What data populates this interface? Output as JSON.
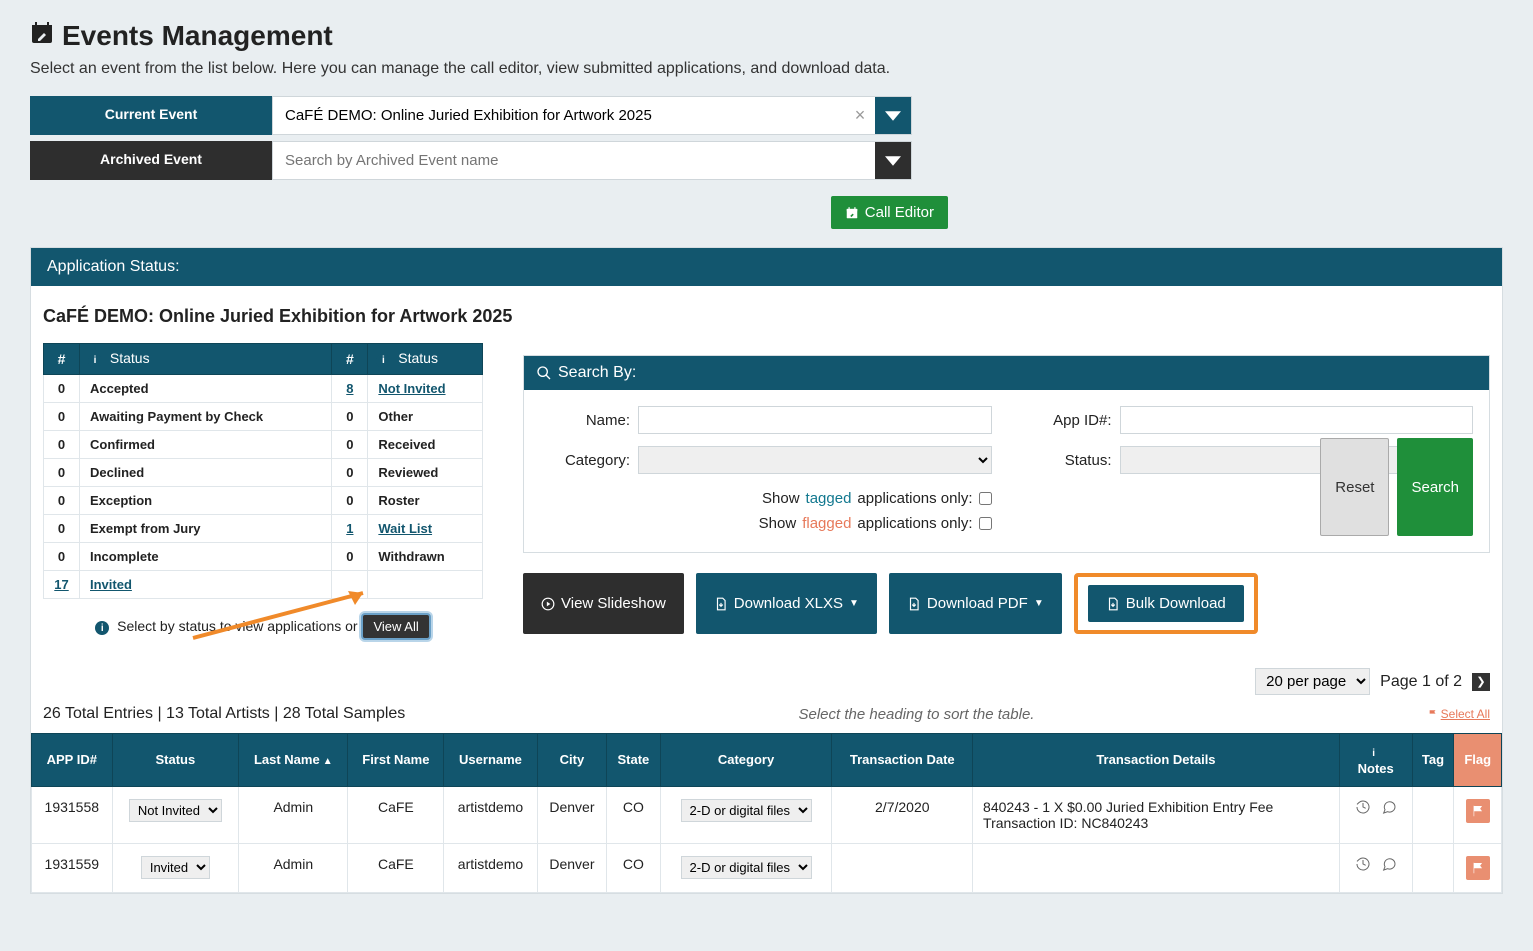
{
  "page": {
    "title": "Events Management",
    "subtitle": "Select an event from the list below. Here you can manage the call editor, view submitted applications, and download data."
  },
  "event_selectors": {
    "current_label": "Current Event",
    "current_value": "CaFÉ DEMO: Online Juried Exhibition for Artwork 2025",
    "archived_label": "Archived Event",
    "archived_placeholder": "Search by Archived Event name"
  },
  "call_editor_btn": "Call Editor",
  "section_header": "Application Status:",
  "event_title": "CaFÉ DEMO: Online Juried Exhibition for Artwork 2025",
  "status_headers": {
    "count": "#",
    "status": "Status"
  },
  "status_left": [
    {
      "count": "0",
      "label": "Accepted",
      "link": false
    },
    {
      "count": "0",
      "label": "Awaiting Payment by Check",
      "link": false
    },
    {
      "count": "0",
      "label": "Confirmed",
      "link": false
    },
    {
      "count": "0",
      "label": "Declined",
      "link": false
    },
    {
      "count": "0",
      "label": "Exception",
      "link": false
    },
    {
      "count": "0",
      "label": "Exempt from Jury",
      "link": false
    },
    {
      "count": "0",
      "label": "Incomplete",
      "link": false
    },
    {
      "count": "17",
      "label": "Invited",
      "link": true
    }
  ],
  "status_right": [
    {
      "count": "8",
      "label": "Not Invited",
      "link": true
    },
    {
      "count": "0",
      "label": "Other",
      "link": false
    },
    {
      "count": "0",
      "label": "Received",
      "link": false
    },
    {
      "count": "0",
      "label": "Reviewed",
      "link": false
    },
    {
      "count": "0",
      "label": "Roster",
      "link": false
    },
    {
      "count": "1",
      "label": "Wait List",
      "link": true
    },
    {
      "count": "0",
      "label": "Withdrawn",
      "link": false
    }
  ],
  "select_hint": "Select by status to view applications or",
  "view_all_btn": "View All",
  "search": {
    "header": "Search By:",
    "name_label": "Name:",
    "appid_label": "App ID#:",
    "category_label": "Category:",
    "status_label": "Status:",
    "tagged_prefix": "Show ",
    "tagged_word": "tagged",
    "tagged_suffix": " applications only:",
    "flagged_prefix": "Show ",
    "flagged_word": "flagged",
    "flagged_suffix": " applications only:",
    "reset_btn": "Reset",
    "search_btn": "Search"
  },
  "dl": {
    "slideshow": "View Slideshow",
    "xlsx": "Download XLXS",
    "pdf": "Download PDF",
    "bulk": "Bulk Download"
  },
  "pager": {
    "per_page": "20 per page",
    "label": "Page 1 of 2"
  },
  "summary": {
    "text": "26 Total Entries | 13 Total Artists | 28 Total Samples",
    "sort_hint": "Select the heading to sort the table.",
    "select_all": "Select All"
  },
  "table": {
    "headers": {
      "app_id": "APP ID#",
      "status": "Status",
      "last_name": "Last Name",
      "first_name": "First Name",
      "username": "Username",
      "city": "City",
      "state": "State",
      "category": "Category",
      "tx_date": "Transaction Date",
      "tx_details": "Transaction Details",
      "notes": "Notes",
      "tag": "Tag",
      "flag": "Flag"
    },
    "rows": [
      {
        "app_id": "1931558",
        "status": "Not Invited",
        "last_name": "Admin",
        "first_name": "CaFE",
        "username": "artistdemo",
        "city": "Denver",
        "state": "CO",
        "category": "2-D or digital files",
        "tx_date": "2/7/2020",
        "tx_details": "840243 - 1 X $0.00 Juried Exhibition Entry Fee\nTransaction ID: NC840243"
      },
      {
        "app_id": "1931559",
        "status": "Invited",
        "last_name": "Admin",
        "first_name": "CaFE",
        "username": "artistdemo",
        "city": "Denver",
        "state": "CO",
        "category": "2-D or digital files",
        "tx_date": "",
        "tx_details": ""
      }
    ]
  }
}
